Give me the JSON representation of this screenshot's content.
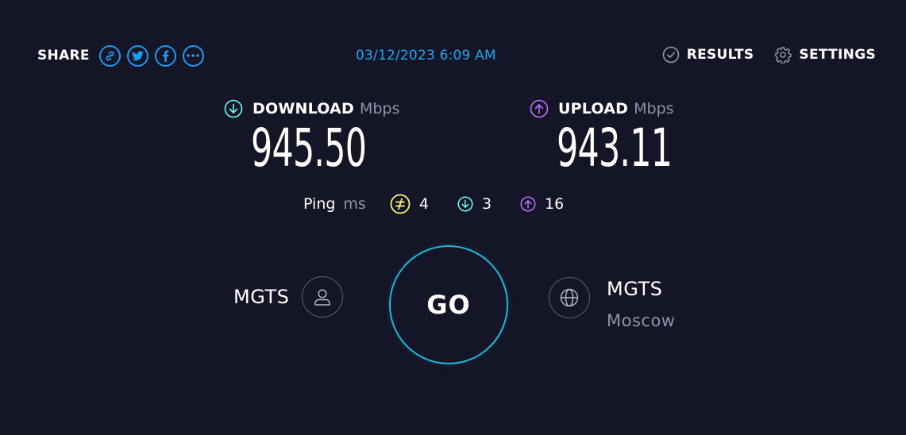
{
  "share": {
    "label": "SHARE",
    "buttons": [
      "link-icon",
      "twitter-icon",
      "facebook-icon",
      "more-icon"
    ]
  },
  "timestamp": "03/12/2023 6:09 AM",
  "nav": {
    "results": "RESULTS",
    "settings": "SETTINGS"
  },
  "download": {
    "label": "DOWNLOAD",
    "unit": "Mbps",
    "value": "945.50",
    "icon": "download-arrow-icon",
    "color": "#6afff3"
  },
  "upload": {
    "label": "UPLOAD",
    "unit": "Mbps",
    "value": "943.11",
    "icon": "upload-arrow-icon",
    "color": "#bf71ff"
  },
  "ping": {
    "label": "Ping",
    "unit": "ms",
    "idle": "4",
    "download": "3",
    "upload": "16",
    "idle_color": "#fbf37a"
  },
  "isp": {
    "name": "MGTS",
    "icon": "user-icon"
  },
  "go_label": "GO",
  "server": {
    "name": "MGTS",
    "location": "Moscow",
    "icon": "globe-icon"
  },
  "colors": {
    "background": "#141526",
    "accent": "#1d9bf0",
    "ring": "#1fb9d8"
  }
}
